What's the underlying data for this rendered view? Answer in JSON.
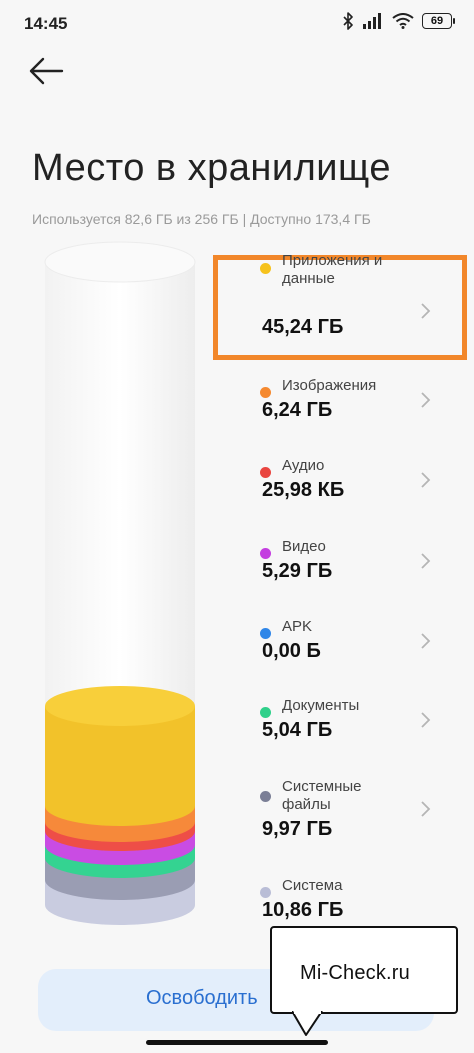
{
  "status_bar": {
    "time": "14:45",
    "battery": "69",
    "icons": [
      "bluetooth-icon",
      "signal-icon",
      "wifi-icon",
      "battery-icon"
    ]
  },
  "page": {
    "title": "Место в хранилище",
    "usage": "Используется 82,6 ГБ из 256 ГБ | Доступно 173,4 ГБ"
  },
  "categories": [
    {
      "label": "Приложения и данные",
      "size": "45,24 ГБ",
      "color": "#f6c21c"
    },
    {
      "label": "Изображения",
      "size": "6,24 ГБ",
      "color": "#f5892f"
    },
    {
      "label": "Аудио",
      "size": "25,98 КБ",
      "color": "#e9453f"
    },
    {
      "label": "Видео",
      "size": "5,29 ГБ",
      "color": "#c43ee0"
    },
    {
      "label": "APK",
      "size": "0,00 Б",
      "color": "#2f86e8"
    },
    {
      "label": "Документы",
      "size": "5,04 ГБ",
      "color": "#2fd08a"
    },
    {
      "label": "Системные файлы",
      "size": "9,97 ГБ",
      "color": "#7b7f96"
    },
    {
      "label": "Система",
      "size": "10,86 ГБ",
      "color": "#b9bdd6"
    }
  ],
  "free_button": {
    "label": "Освободить"
  },
  "watermark": {
    "text": "Mi-Check.ru"
  },
  "colors": {
    "highlight": "#f2872a",
    "accent": "#2a6fd0"
  }
}
